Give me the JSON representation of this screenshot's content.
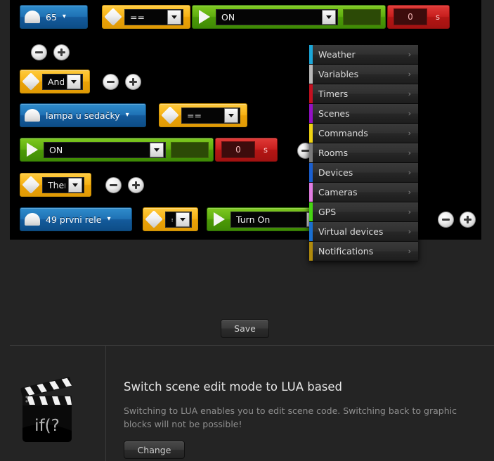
{
  "colors": {
    "canvas_bg": "#000000",
    "page_bg": "#242424",
    "blue_block": "#1f72b5",
    "yellow_block": "#f7b215",
    "green_block": "#5fae10",
    "red_block": "#c81f1e"
  },
  "scene": {
    "rows": [
      {
        "id": "trigger-row",
        "device": {
          "label": "65",
          "icon": "lamp-dome-icon"
        },
        "operator": {
          "value": "=="
        },
        "action": {
          "value": "ON",
          "pad_value": ""
        },
        "timer": {
          "value": "0",
          "unit": "s"
        }
      },
      {
        "id": "condition-row",
        "device": {
          "label": "lampa u sedačky",
          "icon": "lamp-dome-icon"
        },
        "operator": {
          "value": "=="
        },
        "action": {
          "value": "ON",
          "pad_value": ""
        },
        "timer": {
          "value": "0",
          "unit": "s"
        }
      },
      {
        "id": "action-row",
        "device": {
          "label": "49 prvni rele",
          "icon": "lamp-dome-icon"
        },
        "operator": {
          "value": "="
        },
        "action": {
          "value": "Turn On"
        }
      }
    ],
    "connectors": [
      {
        "id": "and-connector",
        "value": "And"
      },
      {
        "id": "then-connector",
        "value": "Then"
      }
    ],
    "buttons": {
      "minus_label": "remove-block-button",
      "plus_label": "add-block-button"
    }
  },
  "side_menu": {
    "items": [
      {
        "label": "Weather",
        "color": "#1ca7d8",
        "chevron": "›"
      },
      {
        "label": "Variables",
        "color": "#b9b9b9",
        "chevron": "›"
      },
      {
        "label": "Timers",
        "color": "#c41020",
        "chevron": "›"
      },
      {
        "label": "Scenes",
        "color": "#9410c4",
        "chevron": "›"
      },
      {
        "label": "Commands",
        "color": "#f0d313",
        "chevron": "›"
      },
      {
        "label": "Rooms",
        "color": "#7a7a7a",
        "chevron": "›"
      },
      {
        "label": "Devices",
        "color": "#1a5fd0",
        "chevron": "›"
      },
      {
        "label": "Cameras",
        "color": "#e27de2",
        "chevron": "›"
      },
      {
        "label": "GPS",
        "color": "#46d413",
        "chevron": "›"
      },
      {
        "label": "Virtual devices",
        "color": "#1a6fd0",
        "chevron": "›"
      },
      {
        "label": "Notifications",
        "color": "#b08a0c",
        "chevron": "›"
      }
    ]
  },
  "save": {
    "label": "Save"
  },
  "lua": {
    "icon": "clapperboard-icon",
    "icon_text": "if(?",
    "title": "Switch scene edit mode to LUA based",
    "description": "Switching to LUA enables you to edit scene code. Switching back to graphic blocks will not be possible!",
    "change_label": "Change"
  }
}
